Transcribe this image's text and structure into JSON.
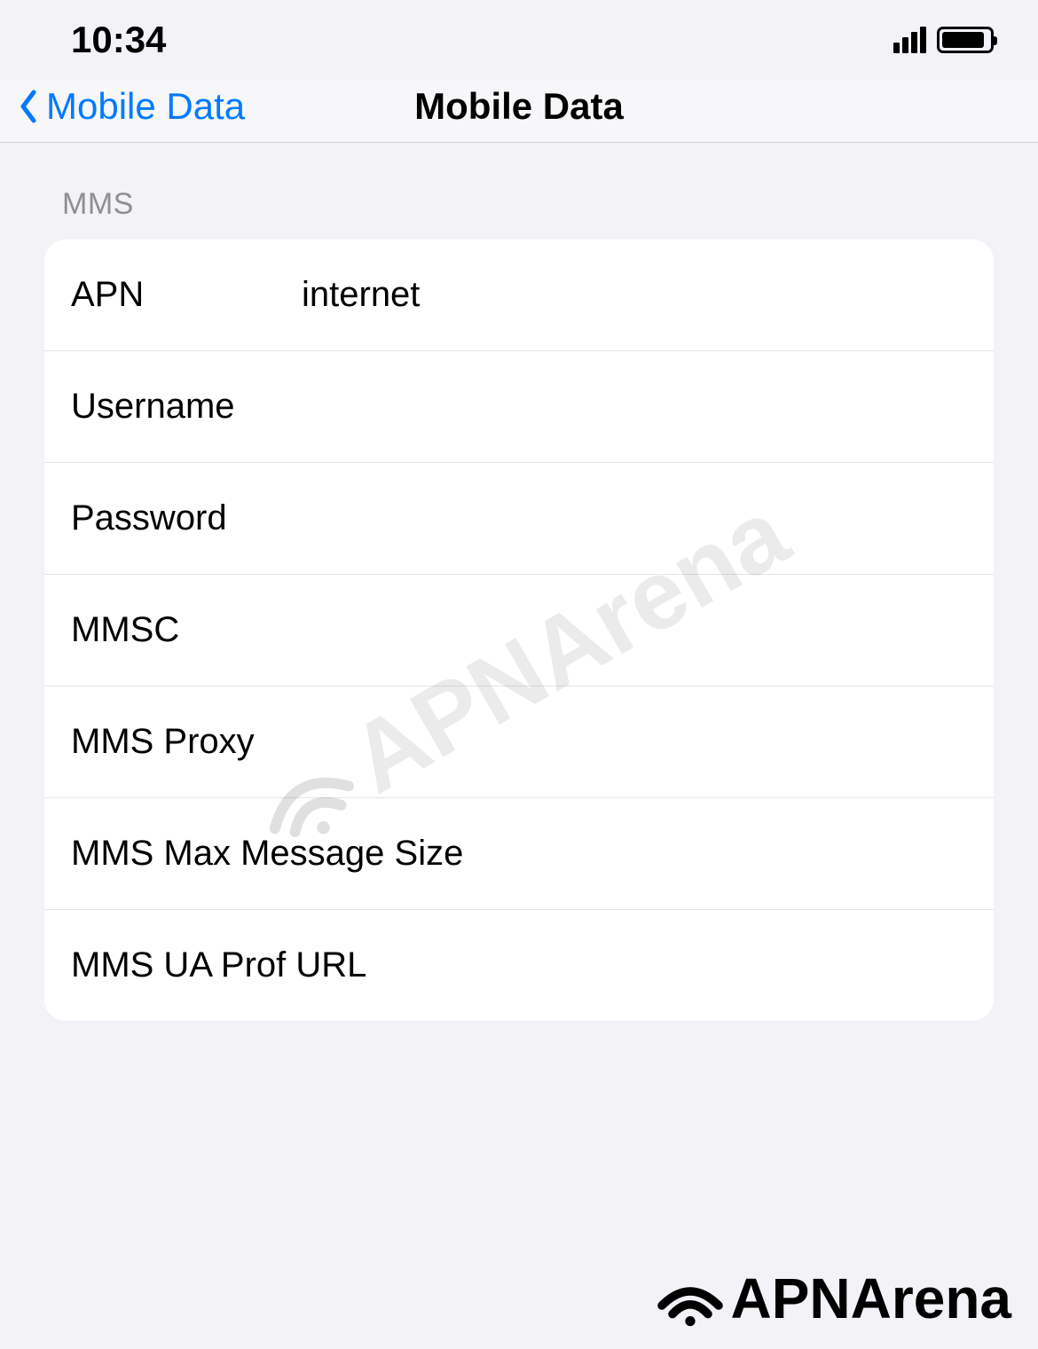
{
  "statusBar": {
    "time": "10:34"
  },
  "nav": {
    "backLabel": "Mobile Data",
    "title": "Mobile Data"
  },
  "section": {
    "header": "MMS",
    "fields": {
      "apn": {
        "label": "APN",
        "value": "internet"
      },
      "username": {
        "label": "Username",
        "value": ""
      },
      "password": {
        "label": "Password",
        "value": ""
      },
      "mmsc": {
        "label": "MMSC",
        "value": ""
      },
      "mmsProxy": {
        "label": "MMS Proxy",
        "value": ""
      },
      "mmsMaxSize": {
        "label": "MMS Max Message Size",
        "value": ""
      },
      "mmsUaProfUrl": {
        "label": "MMS UA Prof URL",
        "value": ""
      }
    }
  },
  "watermark": "APNArena",
  "footerLogo": "APNArena"
}
